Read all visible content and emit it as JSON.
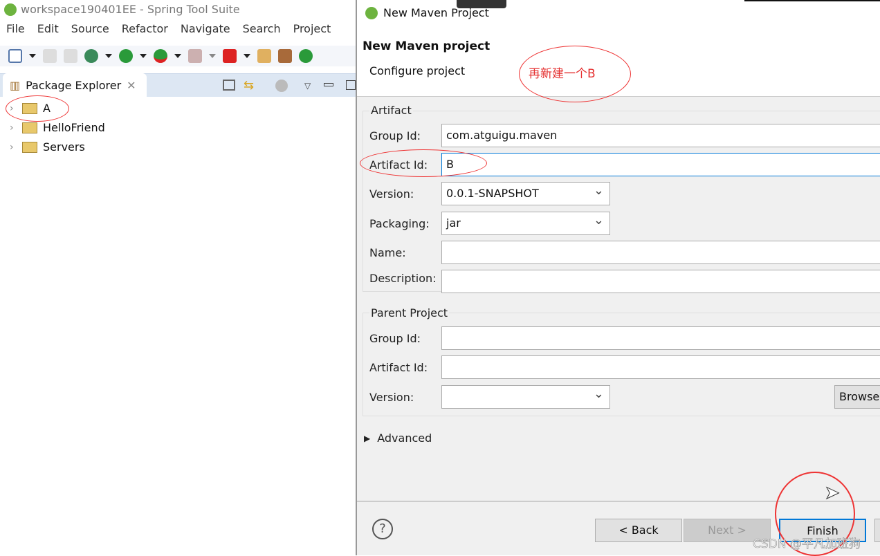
{
  "ide": {
    "title": "workspace190401EE - Spring Tool Suite",
    "menu": [
      "File",
      "Edit",
      "Source",
      "Refactor",
      "Navigate",
      "Search",
      "Project"
    ],
    "view_tab": "Package Explorer",
    "projects": [
      "A",
      "HelloFriend",
      "Servers"
    ]
  },
  "dialog": {
    "title": "New Maven Project",
    "heading": "New Maven project",
    "subheading": "Configure project",
    "annotation": "再新建一个B",
    "artifact": {
      "legend": "Artifact",
      "group_id_label": "Group Id:",
      "group_id": "com.atguigu.maven",
      "artifact_id_label": "Artifact Id:",
      "artifact_id": "B",
      "version_label": "Version:",
      "version": "0.0.1-SNAPSHOT",
      "packaging_label": "Packaging:",
      "packaging": "jar",
      "name_label": "Name:",
      "name": "",
      "description_label": "Description:",
      "description": ""
    },
    "parent": {
      "legend": "Parent Project",
      "group_id_label": "Group Id:",
      "artifact_id_label": "Artifact Id:",
      "version_label": "Version:",
      "browse": "Browse"
    },
    "advanced": "Advanced",
    "buttons": {
      "help": "?",
      "back": "< Back",
      "next": "Next >",
      "finish": "Finish"
    }
  },
  "watermark": "CSDN @平凡加班狗",
  "colors": {
    "annotation": "#e53030",
    "focus": "#0078d7"
  }
}
